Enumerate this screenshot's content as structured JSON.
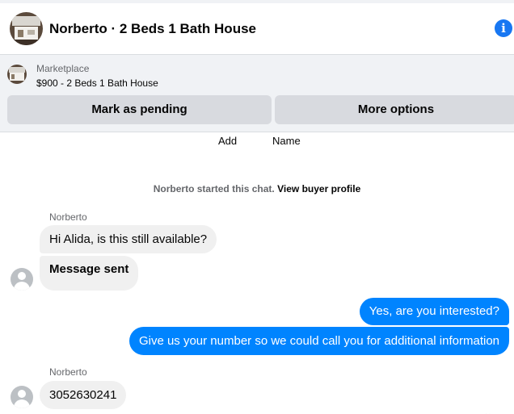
{
  "header": {
    "title": "Norberto · 2 Beds 1 Bath House",
    "info_icon": "info-icon",
    "info_glyph": "i"
  },
  "listing": {
    "label": "Marketplace",
    "description": "$900 - 2 Beds 1 Bath House",
    "pending_label": "Mark as pending",
    "more_label": "More options"
  },
  "actions": {
    "add": "Add",
    "name": "Name"
  },
  "system": {
    "text": "Norberto started this chat.",
    "link": "View buyer profile"
  },
  "messages": [
    {
      "sender": "Norberto",
      "text": "Hi Alida, is this still available?",
      "direction": "incoming"
    },
    {
      "text": "Message sent",
      "direction": "incoming"
    },
    {
      "text": "Yes, are you interested?",
      "direction": "outgoing"
    },
    {
      "text": "Give us your number so we could call you for additional information",
      "direction": "outgoing"
    },
    {
      "sender": "Norberto",
      "text": "3052630241",
      "direction": "incoming"
    }
  ],
  "colors": {
    "accent": "#1877f2",
    "outgoing_bubble": "#0084ff",
    "incoming_bubble": "#f0f0f0",
    "button_bg": "#d8dadf"
  }
}
